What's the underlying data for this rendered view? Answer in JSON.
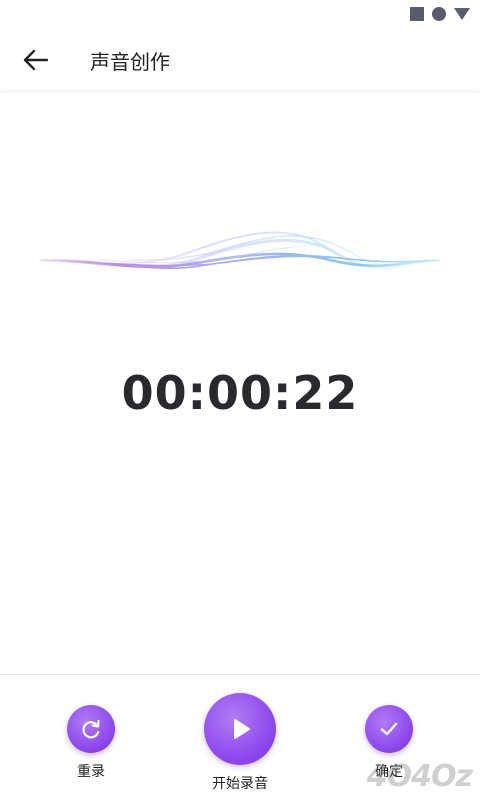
{
  "status_bar": {
    "icons": [
      "square-icon",
      "circle-icon",
      "triangle-icon"
    ]
  },
  "header": {
    "title": "声音创作",
    "back_icon": "arrow-left-icon"
  },
  "timer": {
    "value": "00:00:22"
  },
  "controls": {
    "rerecord_label": "重录",
    "start_label": "开始录音",
    "confirm_label": "确定"
  },
  "watermark": {
    "text": "4O4Oz"
  },
  "colors": {
    "accent": "#8a43ec",
    "accent_light": "#b07cf5",
    "text": "#222222"
  }
}
